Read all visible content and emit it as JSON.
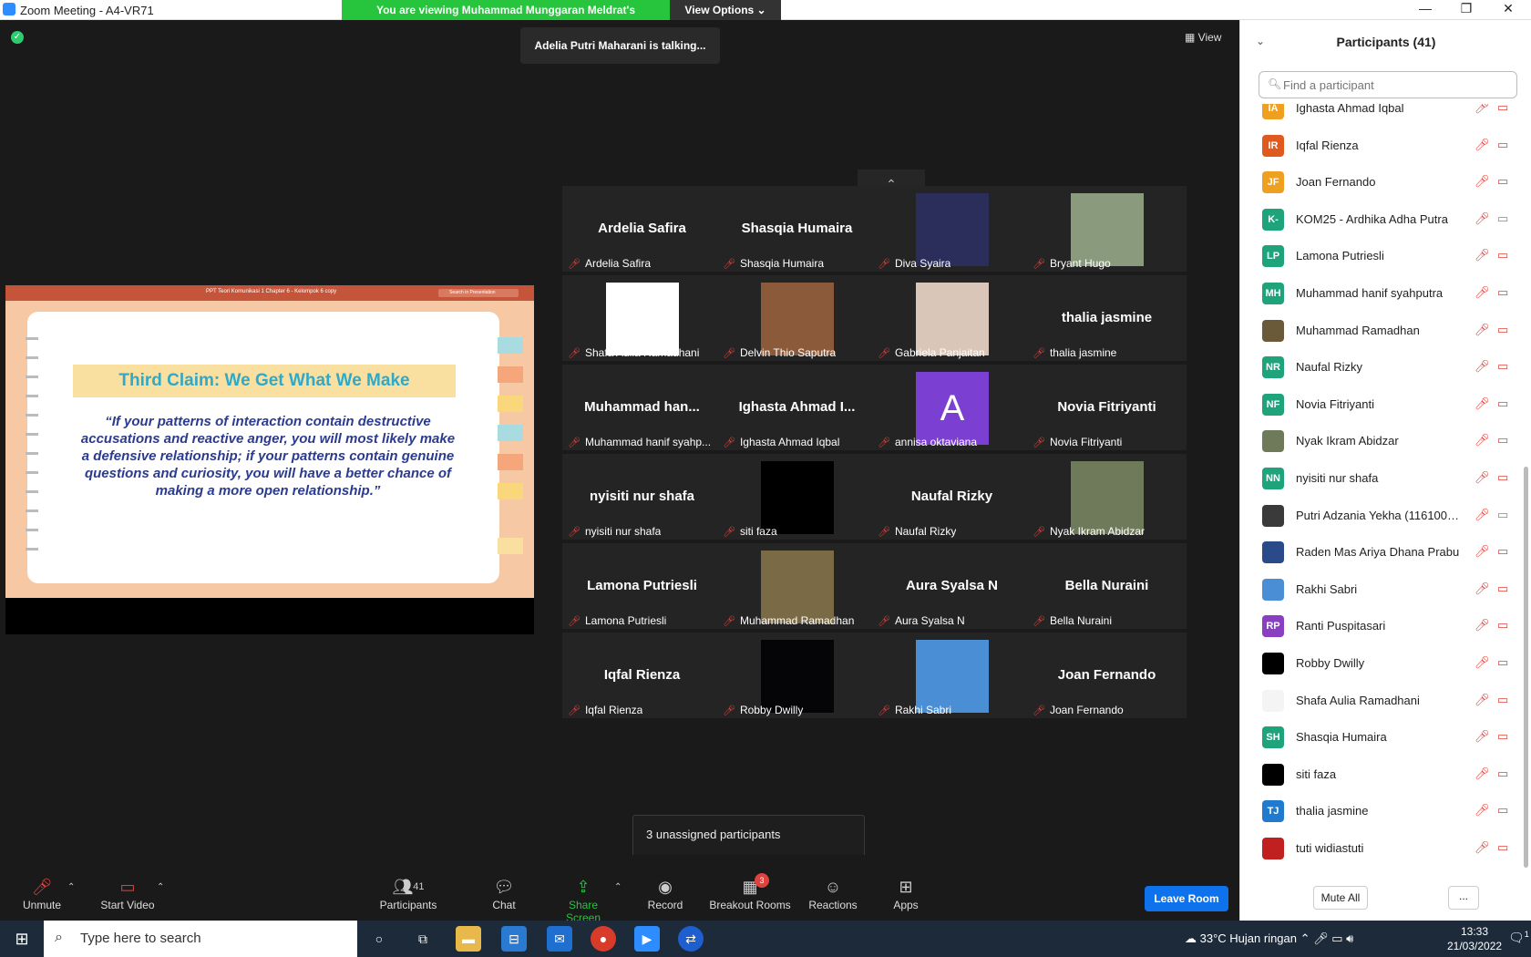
{
  "window": {
    "title": "Zoom Meeting - A4-VR71",
    "minimize": "—",
    "restore": "❐",
    "close": "✕"
  },
  "view_bar": {
    "message": "You are viewing Muhammad Munggaran Meldrat's screen",
    "options": "View Options ⌄"
  },
  "stage": {
    "talking": "Adelia Putri Maharani is talking...",
    "view_label": "View",
    "unassigned": "3 unassigned participants"
  },
  "share": {
    "file_name": "PPT Teori Komunikasi 1 Chapter 6 - Kelompok 6 copy",
    "search_placeholder": "Search in Presentation",
    "slide_title": "Third Claim: We Get What We Make",
    "slide_quote": "“If your patterns of interaction contain destructive accusations and reactive anger, you will most likely make a defensive relationship; if your patterns contain genuine questions and curiosity, you will have a better chance of making a more open relationship.”"
  },
  "tiles": [
    {
      "big": "Ardelia Safira",
      "label": "Ardelia Safira"
    },
    {
      "big": "Shasqia Humaira",
      "label": "Shasqia Humaira"
    },
    {
      "big": "",
      "label": "Diva Syaira",
      "img": "#2b2d5a"
    },
    {
      "big": "",
      "label": "Bryant Hugo",
      "img": "#8a9a7c"
    },
    {
      "big": "",
      "label": "Shafa Aulia Ramadhani",
      "img": "#ffffff"
    },
    {
      "big": "",
      "label": "Delvin Thio Saputra",
      "img": "#8a5a3a"
    },
    {
      "big": "",
      "label": "Gabriela Panjaitan",
      "img": "#d9c6b8"
    },
    {
      "big": "thalia jasmine",
      "label": "thalia jasmine"
    },
    {
      "big": "Muhammad  han...",
      "label": "Muhammad hanif syahp..."
    },
    {
      "big": "Ighasta Ahmad I...",
      "label": "Ighasta Ahmad Iqbal"
    },
    {
      "big": "",
      "label": "annisa oktaviana",
      "img": "#7b3fd1",
      "letter": "A"
    },
    {
      "big": "Novia Fitriyanti",
      "label": "Novia Fitriyanti"
    },
    {
      "big": "nyisiti nur shafa",
      "label": "nyisiti nur shafa"
    },
    {
      "big": "",
      "label": "siti faza",
      "img": "#000000"
    },
    {
      "big": "Naufal Rizky",
      "label": "Naufal Rizky"
    },
    {
      "big": "",
      "label": "Nyak Ikram Abidzar",
      "img": "#6f7a5a"
    },
    {
      "big": "Lamona Putriesli",
      "label": "Lamona Putriesli"
    },
    {
      "big": "",
      "label": "Muhammad Ramadhan",
      "img": "#7a6a45"
    },
    {
      "big": "Aura Syalsa N",
      "label": "Aura Syalsa N"
    },
    {
      "big": "Bella Nuraini",
      "label": "Bella Nuraini"
    },
    {
      "big": "Iqfal Rienza",
      "label": "Iqfal Rienza"
    },
    {
      "big": "",
      "label": "Robby Dwilly",
      "img": "#050508"
    },
    {
      "big": "",
      "label": "Rakhi Sabri",
      "img": "#4a8fd6"
    },
    {
      "big": "Joan Fernando",
      "label": "Joan Fernando"
    }
  ],
  "toolbar": {
    "unmute": "Unmute",
    "start_video": "Start Video",
    "participants": "Participants",
    "participants_count": "41",
    "chat": "Chat",
    "share_screen": "Share Screen",
    "record": "Record",
    "breakout": "Breakout Rooms",
    "breakout_badge": "3",
    "reactions": "Reactions",
    "apps": "Apps",
    "leave": "Leave Room"
  },
  "panel": {
    "title": "Participants (41)",
    "search_placeholder": "Find a participant",
    "mute_all": "Mute All",
    "more": "...",
    "participants": [
      {
        "initials": "IA",
        "name": "Ighasta Ahmad Iqbal",
        "color": "#f0a020"
      },
      {
        "initials": "IR",
        "name": "Iqfal Rienza",
        "color": "#e05a1f"
      },
      {
        "initials": "JF",
        "name": "Joan Fernando",
        "color": "#f0a020"
      },
      {
        "initials": "K-",
        "name": "KOM25 - Ardhika Adha Putra",
        "color": "#1fa37a",
        "video": true
      },
      {
        "initials": "LP",
        "name": "Lamona Putriesli",
        "color": "#1fa37a"
      },
      {
        "initials": "MH",
        "name": "Muhammad hanif syahputra",
        "color": "#1fa37a"
      },
      {
        "initials": "",
        "name": "Muhammad Ramadhan",
        "color": "#6a5a3a"
      },
      {
        "initials": "NR",
        "name": "Naufal Rizky",
        "color": "#1fa37a"
      },
      {
        "initials": "NF",
        "name": "Novia Fitriyanti",
        "color": "#1fa37a"
      },
      {
        "initials": "",
        "name": "Nyak Ikram Abidzar",
        "color": "#6f7a5a"
      },
      {
        "initials": "NN",
        "name": "nyisiti nur shafa",
        "color": "#1fa37a"
      },
      {
        "initials": "",
        "name": "Putri Adzania Yekha (11610033...",
        "color": "#3a3a3a",
        "video": true
      },
      {
        "initials": "",
        "name": "Raden Mas Ariya Dhana Prabu",
        "color": "#2a4a8a"
      },
      {
        "initials": "",
        "name": "Rakhi Sabri",
        "color": "#4a8fd6"
      },
      {
        "initials": "RP",
        "name": "Ranti Puspitasari",
        "color": "#8a3fc1"
      },
      {
        "initials": "",
        "name": "Robby Dwilly",
        "color": "#000000"
      },
      {
        "initials": "",
        "name": "Shafa Aulia Ramadhani",
        "color": "#f4f4f4"
      },
      {
        "initials": "SH",
        "name": "Shasqia Humaira",
        "color": "#1fa37a"
      },
      {
        "initials": "",
        "name": "siti faza",
        "color": "#000000"
      },
      {
        "initials": "TJ",
        "name": "thalia jasmine",
        "color": "#1f7ad0"
      },
      {
        "initials": "",
        "name": "tuti widiastuti",
        "color": "#c0201f"
      }
    ]
  },
  "taskbar": {
    "search_placeholder": "Type here to search",
    "weather": "33°C  Hujan ringan",
    "time": "13:33",
    "date": "21/03/2022",
    "notif_count": "1"
  }
}
